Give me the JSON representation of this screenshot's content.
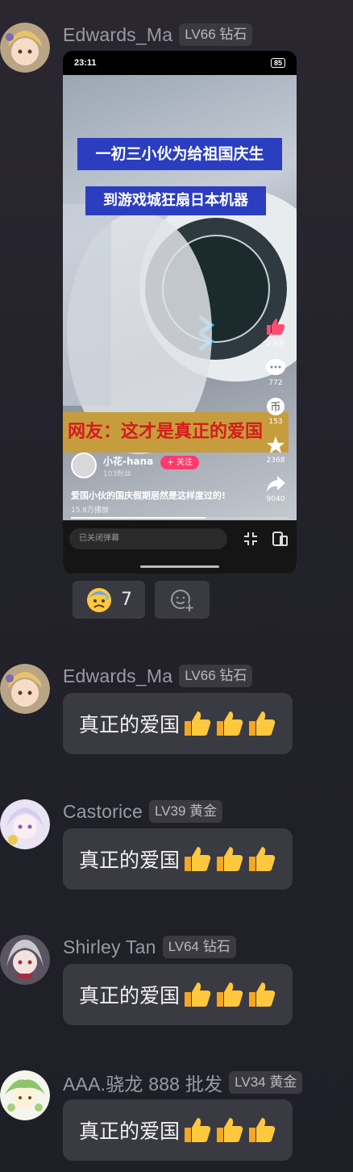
{
  "messages": [
    {
      "user": "Edwards_Ma",
      "badge": "LV66 钻石"
    },
    {
      "user": "Edwards_Ma",
      "badge": "LV66 钻石",
      "text": "真正的爱国"
    },
    {
      "user": "Castorice",
      "badge": "LV39 黄金",
      "text": "真正的爱国"
    },
    {
      "user": "Shirley Tan",
      "badge": "LV64 钻石",
      "text": "真正的爱国"
    },
    {
      "user": "AAA.骁龙 888 批发",
      "badge": "LV34 黄金",
      "text": "真正的爱国"
    }
  ],
  "screenshot": {
    "time": "23:11",
    "battery": "85",
    "caption_top": "一初三小伙为给祖国庆生",
    "caption_mid": "到游戏城狂扇日本机器",
    "caption_bottom": "网友：这才是真正的爱国",
    "author_name": "小花-hana",
    "author_fans": "103粉丝",
    "follow_label": "+ 关注",
    "likes": "2.9万",
    "comments": "772",
    "coins": "153",
    "favorites": "2368",
    "shares": "9040",
    "description": "爱国小伙的国庆假期居然是这样度过的!",
    "plays": "15.6万播放",
    "progress": 0.62,
    "danmu_placeholder": "已关闭弹幕"
  },
  "reactions": {
    "emoji_icon": "anxious-sweat-face-icon",
    "count": "7",
    "add_icon": "add-reaction-icon"
  },
  "colors": {
    "background": "#23222b",
    "bubble": "#3a3a42",
    "badge": "#3b3a43",
    "name_text": "#9a9aa4"
  }
}
